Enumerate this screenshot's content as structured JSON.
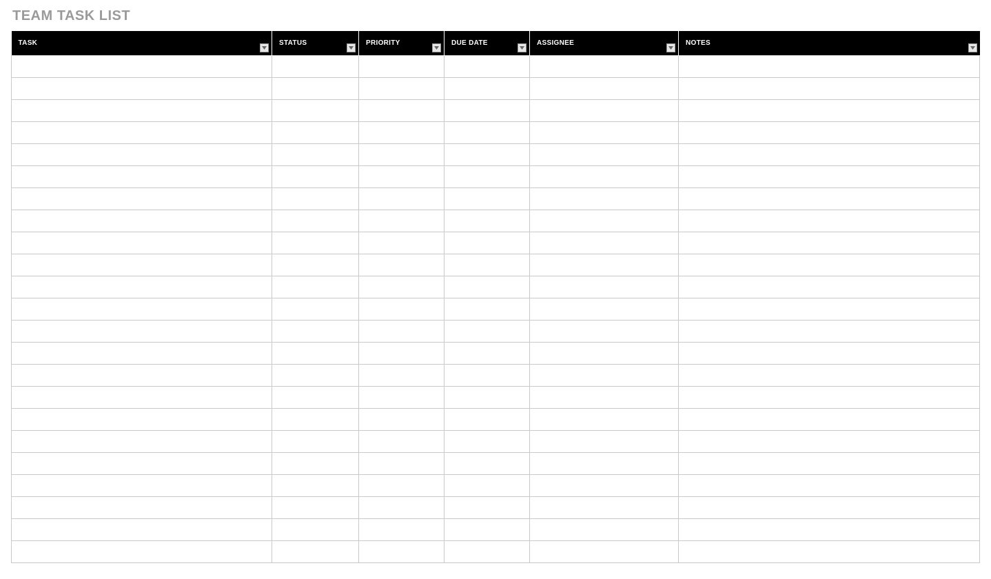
{
  "title": "TEAM TASK LIST",
  "columns": [
    {
      "label": "TASK",
      "key": "task",
      "filter": true
    },
    {
      "label": "STATUS",
      "key": "status",
      "filter": true
    },
    {
      "label": "PRIORITY",
      "key": "priority",
      "filter": true
    },
    {
      "label": "DUE DATE",
      "key": "duedate",
      "filter": true
    },
    {
      "label": "ASSIGNEE",
      "key": "assignee",
      "filter": true
    },
    {
      "label": "NOTES",
      "key": "notes",
      "filter": true
    }
  ],
  "rows": [
    {
      "task": "",
      "status": "",
      "priority": "",
      "duedate": "",
      "assignee": "",
      "notes": ""
    },
    {
      "task": "",
      "status": "",
      "priority": "",
      "duedate": "",
      "assignee": "",
      "notes": ""
    },
    {
      "task": "",
      "status": "",
      "priority": "",
      "duedate": "",
      "assignee": "",
      "notes": ""
    },
    {
      "task": "",
      "status": "",
      "priority": "",
      "duedate": "",
      "assignee": "",
      "notes": ""
    },
    {
      "task": "",
      "status": "",
      "priority": "",
      "duedate": "",
      "assignee": "",
      "notes": ""
    },
    {
      "task": "",
      "status": "",
      "priority": "",
      "duedate": "",
      "assignee": "",
      "notes": ""
    },
    {
      "task": "",
      "status": "",
      "priority": "",
      "duedate": "",
      "assignee": "",
      "notes": ""
    },
    {
      "task": "",
      "status": "",
      "priority": "",
      "duedate": "",
      "assignee": "",
      "notes": ""
    },
    {
      "task": "",
      "status": "",
      "priority": "",
      "duedate": "",
      "assignee": "",
      "notes": ""
    },
    {
      "task": "",
      "status": "",
      "priority": "",
      "duedate": "",
      "assignee": "",
      "notes": ""
    },
    {
      "task": "",
      "status": "",
      "priority": "",
      "duedate": "",
      "assignee": "",
      "notes": ""
    },
    {
      "task": "",
      "status": "",
      "priority": "",
      "duedate": "",
      "assignee": "",
      "notes": ""
    },
    {
      "task": "",
      "status": "",
      "priority": "",
      "duedate": "",
      "assignee": "",
      "notes": ""
    },
    {
      "task": "",
      "status": "",
      "priority": "",
      "duedate": "",
      "assignee": "",
      "notes": ""
    },
    {
      "task": "",
      "status": "",
      "priority": "",
      "duedate": "",
      "assignee": "",
      "notes": ""
    },
    {
      "task": "",
      "status": "",
      "priority": "",
      "duedate": "",
      "assignee": "",
      "notes": ""
    },
    {
      "task": "",
      "status": "",
      "priority": "",
      "duedate": "",
      "assignee": "",
      "notes": ""
    },
    {
      "task": "",
      "status": "",
      "priority": "",
      "duedate": "",
      "assignee": "",
      "notes": ""
    },
    {
      "task": "",
      "status": "",
      "priority": "",
      "duedate": "",
      "assignee": "",
      "notes": ""
    },
    {
      "task": "",
      "status": "",
      "priority": "",
      "duedate": "",
      "assignee": "",
      "notes": ""
    },
    {
      "task": "",
      "status": "",
      "priority": "",
      "duedate": "",
      "assignee": "",
      "notes": ""
    },
    {
      "task": "",
      "status": "",
      "priority": "",
      "duedate": "",
      "assignee": "",
      "notes": ""
    },
    {
      "task": "",
      "status": "",
      "priority": "",
      "duedate": "",
      "assignee": "",
      "notes": ""
    }
  ]
}
